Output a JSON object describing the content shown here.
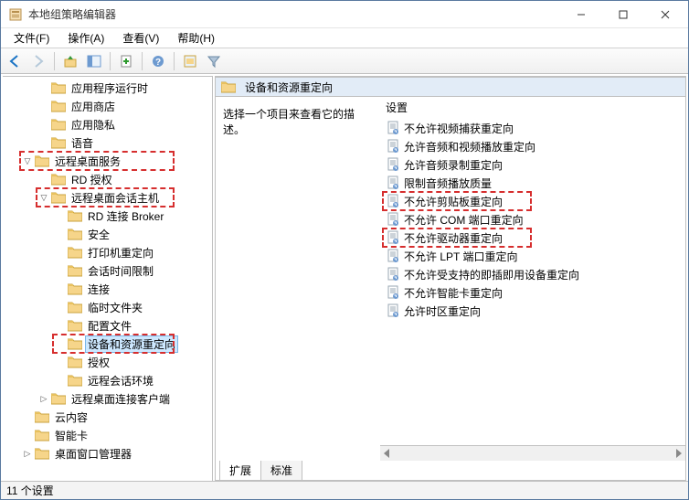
{
  "window": {
    "title": "本地组策略编辑器"
  },
  "menus": [
    "文件(F)",
    "操作(A)",
    "查看(V)",
    "帮助(H)"
  ],
  "tree": [
    {
      "label": "应用程序运行时",
      "indent": 2,
      "exp": ""
    },
    {
      "label": "应用商店",
      "indent": 2,
      "exp": ""
    },
    {
      "label": "应用隐私",
      "indent": 2,
      "exp": ""
    },
    {
      "label": "语音",
      "indent": 2,
      "exp": ""
    },
    {
      "label": "远程桌面服务",
      "indent": 1,
      "exp": "v",
      "hl": true
    },
    {
      "label": "RD 授权",
      "indent": 2,
      "exp": ""
    },
    {
      "label": "远程桌面会话主机",
      "indent": 2,
      "exp": "v",
      "hl": true
    },
    {
      "label": "RD 连接 Broker",
      "indent": 3,
      "exp": ""
    },
    {
      "label": "安全",
      "indent": 3,
      "exp": ""
    },
    {
      "label": "打印机重定向",
      "indent": 3,
      "exp": ""
    },
    {
      "label": "会话时间限制",
      "indent": 3,
      "exp": ""
    },
    {
      "label": "连接",
      "indent": 3,
      "exp": ""
    },
    {
      "label": "临时文件夹",
      "indent": 3,
      "exp": ""
    },
    {
      "label": "配置文件",
      "indent": 3,
      "exp": ""
    },
    {
      "label": "设备和资源重定向",
      "indent": 3,
      "exp": "",
      "selected": true,
      "hl": true
    },
    {
      "label": "授权",
      "indent": 3,
      "exp": ""
    },
    {
      "label": "远程会话环境",
      "indent": 3,
      "exp": ""
    },
    {
      "label": "远程桌面连接客户端",
      "indent": 2,
      "exp": ">"
    },
    {
      "label": "云内容",
      "indent": 1,
      "exp": ""
    },
    {
      "label": "智能卡",
      "indent": 1,
      "exp": ""
    },
    {
      "label": "桌面窗口管理器",
      "indent": 1,
      "exp": ">"
    }
  ],
  "detail": {
    "title": "设备和资源重定向",
    "prompt": "选择一个项目来查看它的描述。",
    "column_header": "设置",
    "items": [
      {
        "label": "不允许视频捕获重定向"
      },
      {
        "label": "允许音频和视频播放重定向"
      },
      {
        "label": "允许音频录制重定向"
      },
      {
        "label": "限制音频播放质量"
      },
      {
        "label": "不允许剪贴板重定向",
        "hl": true
      },
      {
        "label": "不允许 COM 端口重定向"
      },
      {
        "label": "不允许驱动器重定向",
        "hl": true
      },
      {
        "label": "不允许 LPT 端口重定向"
      },
      {
        "label": "不允许受支持的即插即用设备重定向"
      },
      {
        "label": "不允许智能卡重定向"
      },
      {
        "label": "允许时区重定向"
      }
    ]
  },
  "tabs": {
    "extended": "扩展",
    "standard": "标准"
  },
  "status": "11 个设置"
}
